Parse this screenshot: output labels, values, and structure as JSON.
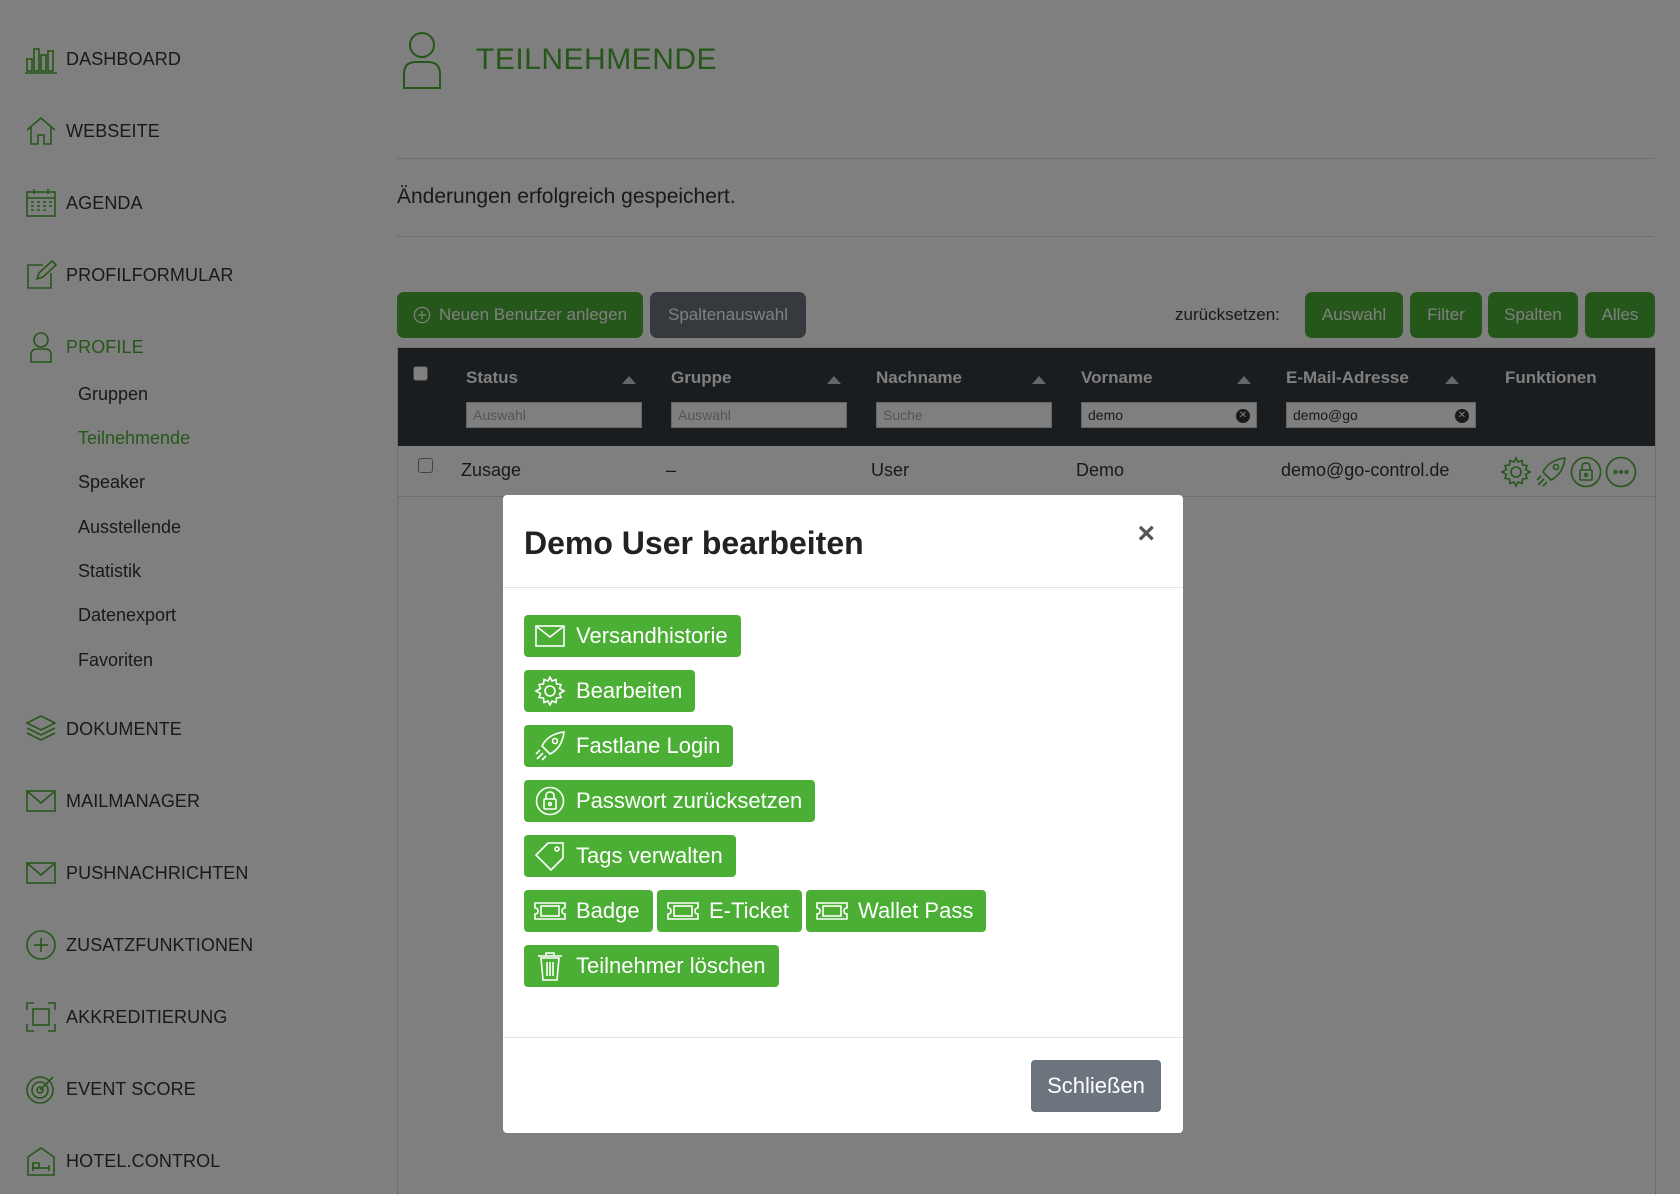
{
  "sidebar": {
    "items": [
      {
        "label": "DASHBOARD",
        "icon": "bar-chart-icon"
      },
      {
        "label": "WEBSEITE",
        "icon": "home-icon"
      },
      {
        "label": "AGENDA",
        "icon": "calendar-icon"
      },
      {
        "label": "PROFILFORMULAR",
        "icon": "edit-icon"
      },
      {
        "label": "PROFILE",
        "icon": "user-icon",
        "active": true
      },
      {
        "label": "DOKUMENTE",
        "icon": "layers-icon"
      },
      {
        "label": "MAILMANAGER",
        "icon": "mail-icon"
      },
      {
        "label": "PUSHNACHRICHTEN",
        "icon": "mail-icon"
      },
      {
        "label": "ZUSATZFUNKTIONEN",
        "icon": "plus-circle-icon"
      },
      {
        "label": "AKKREDITIERUNG",
        "icon": "scan-icon"
      },
      {
        "label": "EVENT SCORE",
        "icon": "target-icon"
      },
      {
        "label": "HOTEL.CONTROL",
        "icon": "hotel-icon"
      }
    ],
    "subitems": [
      "Gruppen",
      "Teilnehmende",
      "Speaker",
      "Ausstellende",
      "Statistik",
      "Datenexport",
      "Favoriten"
    ],
    "active_subitem": "Teilnehmende"
  },
  "page": {
    "title": "TEILNEHMENDE",
    "success_message": "Änderungen erfolgreich gespeichert."
  },
  "toolbar": {
    "new_user": "Neuen Benutzer anlegen",
    "columns": "Spaltenauswahl",
    "reset_label": "zurücksetzen:",
    "reset_selection": "Auswahl",
    "reset_filter": "Filter",
    "reset_columns": "Spalten",
    "reset_all": "Alles"
  },
  "table": {
    "headers": [
      "Status",
      "Gruppe",
      "Nachname",
      "Vorname",
      "E-Mail-Adresse",
      "Funktionen"
    ],
    "filters": [
      {
        "placeholder": "Auswahl",
        "value": ""
      },
      {
        "placeholder": "Auswahl",
        "value": ""
      },
      {
        "placeholder": "Suche",
        "value": ""
      },
      {
        "placeholder": "",
        "value": "demo"
      },
      {
        "placeholder": "",
        "value": "demo@go"
      }
    ],
    "rows": [
      {
        "status": "Zusage",
        "gruppe": "–",
        "nachname": "User",
        "vorname": "Demo",
        "email": "demo@go-control.de"
      }
    ]
  },
  "modal": {
    "title": "Demo User bearbeiten",
    "close_symbol": "×",
    "actions": [
      {
        "label": "Versandhistorie",
        "icon": "mail-icon"
      },
      {
        "label": "Bearbeiten",
        "icon": "gear-icon"
      },
      {
        "label": "Fastlane Login",
        "icon": "rocket-icon"
      },
      {
        "label": "Passwort zurücksetzen",
        "icon": "lock-icon"
      },
      {
        "label": "Tags verwalten",
        "icon": "tag-icon"
      },
      {
        "label": "Badge",
        "icon": "ticket-icon"
      },
      {
        "label": "E-Ticket",
        "icon": "ticket-icon"
      },
      {
        "label": "Wallet Pass",
        "icon": "ticket-icon"
      },
      {
        "label": "Teilnehmer löschen",
        "icon": "trash-icon"
      }
    ],
    "close_button": "Schließen"
  },
  "colors": {
    "accent": "#4caf35",
    "dark_header": "#343a40",
    "grey_button": "#6c757d"
  }
}
